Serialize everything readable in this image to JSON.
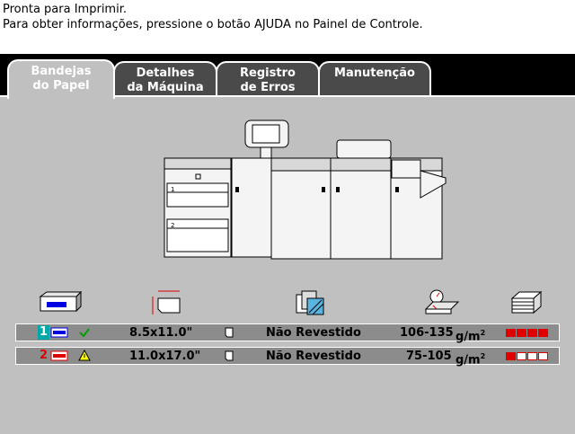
{
  "status": {
    "line1": "Pronta para  Imprimir.",
    "line2": "Para  obter  informações,  pressione  o  botão  AJUDA  no  Painel  de  Controle."
  },
  "tabs": [
    {
      "line1": "Bandejas",
      "line2": "do  Papel",
      "active": true
    },
    {
      "line1": "Detalhes",
      "line2": "da  Máquina",
      "active": false
    },
    {
      "line1": "Registro",
      "line2": "de  Erros",
      "active": false
    },
    {
      "line1": "Manutenção",
      "line2": "",
      "active": false
    }
  ],
  "column_icons": [
    "paper-tray-icon",
    "paper-size-icon",
    "paper-type-icon",
    "paper-weight-icon",
    "paper-stack-level-icon"
  ],
  "trays": [
    {
      "number": "1",
      "status_icon": "check-icon",
      "size": "8.5x11.0\"",
      "orientation_icon": "paper-portrait-icon",
      "type": "Não  Revestido",
      "weight": "106-135",
      "unit": "g/m",
      "unit_sup": "2",
      "level_fill": 4,
      "level_total": 4
    },
    {
      "number": "2",
      "status_icon": "warning-icon",
      "size": "11.0x17.0\"",
      "orientation_icon": "paper-portrait-icon",
      "type": "Não  Revestido",
      "weight": "75-105",
      "unit": "g/m",
      "unit_sup": "2",
      "level_fill": 1,
      "level_total": 4
    }
  ],
  "colors": {
    "accent_red": "#e00000",
    "selected_tray": "#00a8a8",
    "tab_bg": "#4a4a4a",
    "panel_bg": "#c0c0c0"
  }
}
